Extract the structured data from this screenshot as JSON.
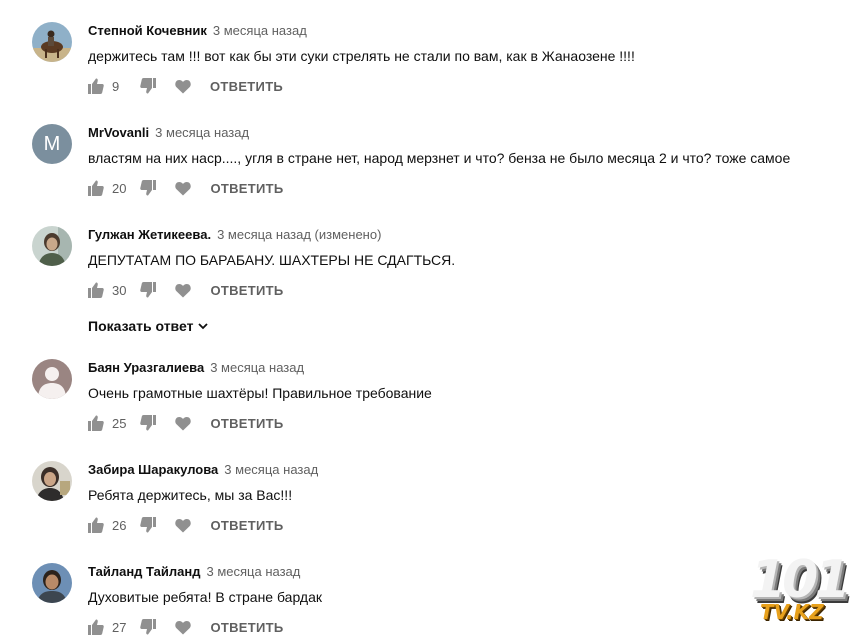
{
  "comments": [
    {
      "author": "Степной Кочевник",
      "time": "3 месяца назад",
      "text": "держитесь там !!! вот как бы эти суки  стрелять не стали по вам, как в Жанаозене !!!!",
      "likes": "9",
      "reply": "ОТВЕТИТЬ"
    },
    {
      "author": "MrVovanli",
      "avatar_letter": "M",
      "time": "3 месяца назад",
      "text": "властям на них наср...., угля в стране нет, народ мерзнет и что? бенза не было месяца 2 и что? тоже самое",
      "likes": "20",
      "reply": "ОТВЕТИТЬ"
    },
    {
      "author": "Гулжан Жетикеева.",
      "time": "3 месяца назад (изменено)",
      "text": "ДЕПУТАТАМ ПО БАРАБАНУ. ШАХТЕРЫ НЕ СДАГТЬСЯ.",
      "likes": "30",
      "reply": "ОТВЕТИТЬ"
    },
    {
      "author": "Баян Уразгалиева",
      "time": "3 месяца назад",
      "text": "Очень грамотные шахтёры! Правильное требование",
      "likes": "25",
      "reply": "ОТВЕТИТЬ"
    },
    {
      "author": "Забира Шаракулова",
      "time": "3 месяца назад",
      "text": "Ребята держитесь, мы за Вас!!!",
      "likes": "26",
      "reply": "ОТВЕТИТЬ"
    },
    {
      "author": "Тайланд Тайланд",
      "time": "3 месяца назад",
      "text": "Духовитые ребята! В стране бардак",
      "likes": "27",
      "reply": "ОТВЕТИТЬ"
    }
  ],
  "show_replies_label": "Показать ответ",
  "logo": {
    "digits": "101",
    "sub": "TV.KZ"
  },
  "colors": {
    "avatar_m": "#7b8f9e",
    "avatar_default": "#9a8582",
    "logo_orange": "#e8a11c"
  },
  "icons": [
    "thumb-up-icon",
    "thumb-down-icon",
    "heart-icon",
    "chevron-down-icon"
  ]
}
